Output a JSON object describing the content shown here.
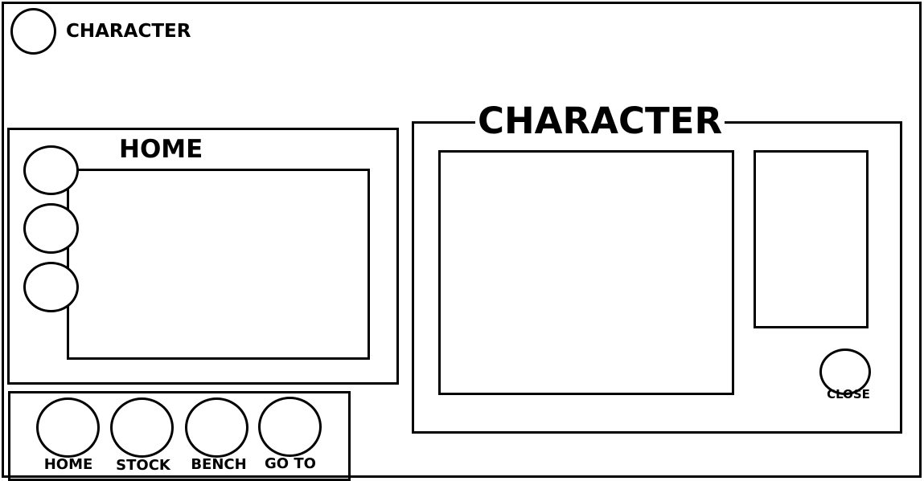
{
  "header": {
    "title": "CHARACTER"
  },
  "home_panel": {
    "title": "HOME"
  },
  "nav": {
    "items": [
      {
        "label": "HOME"
      },
      {
        "label": "STOCK"
      },
      {
        "label": "BENCH"
      },
      {
        "label": "GO TO"
      }
    ]
  },
  "character_panel": {
    "title": "CHARACTER",
    "close_label": "CLOSE"
  }
}
